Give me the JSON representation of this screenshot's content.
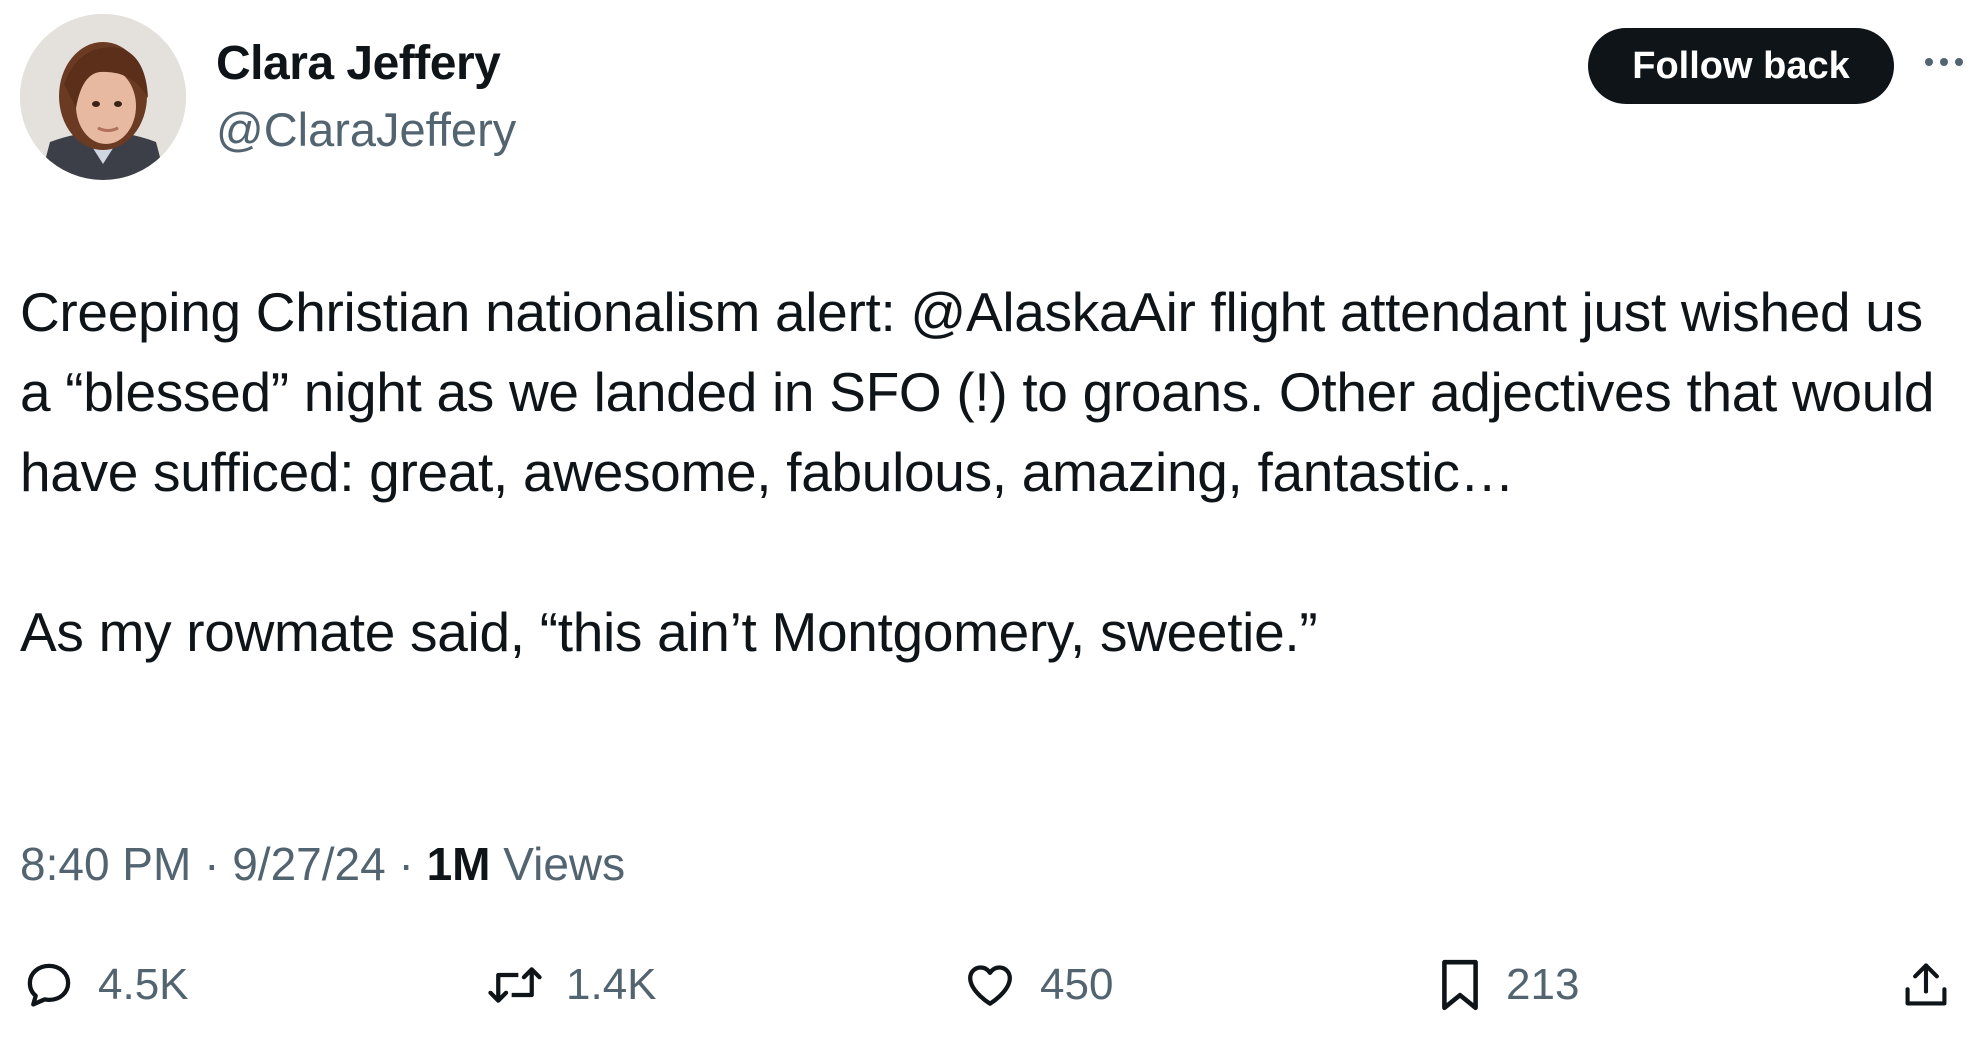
{
  "author": {
    "name": "Clara Jeffery",
    "handle": "@ClaraJeffery"
  },
  "follow_button_label": "Follow back",
  "tweet": {
    "paragraph1": {
      "before": "Creeping Christian nationalism alert: ",
      "mention": "@AlaskaAir",
      "after": " flight attendant just wished us a “blessed” night as we landed in SFO (!) to groans. Other adjectives that would have sufficed: great, awesome, fabulous, amazing, fantastic…"
    },
    "paragraph2": "As my rowmate said, “this ain’t Montgomery, sweetie.”"
  },
  "meta": {
    "time": "8:40 PM",
    "date": "9/27/24",
    "views_count": "1M",
    "views_label": "Views"
  },
  "actions": {
    "replies": "4.5K",
    "reposts": "1.4K",
    "likes": "450",
    "bookmarks": "213"
  },
  "icons": {
    "reply": "reply-icon",
    "repost": "repost-icon",
    "like": "heart-icon",
    "bookmark": "bookmark-icon",
    "share": "share-icon",
    "more": "more-dots-icon"
  },
  "colors": {
    "text_primary": "#0f1419",
    "text_secondary": "#536471",
    "button_bg": "#0f1419",
    "button_text": "#ffffff",
    "background": "#ffffff"
  }
}
